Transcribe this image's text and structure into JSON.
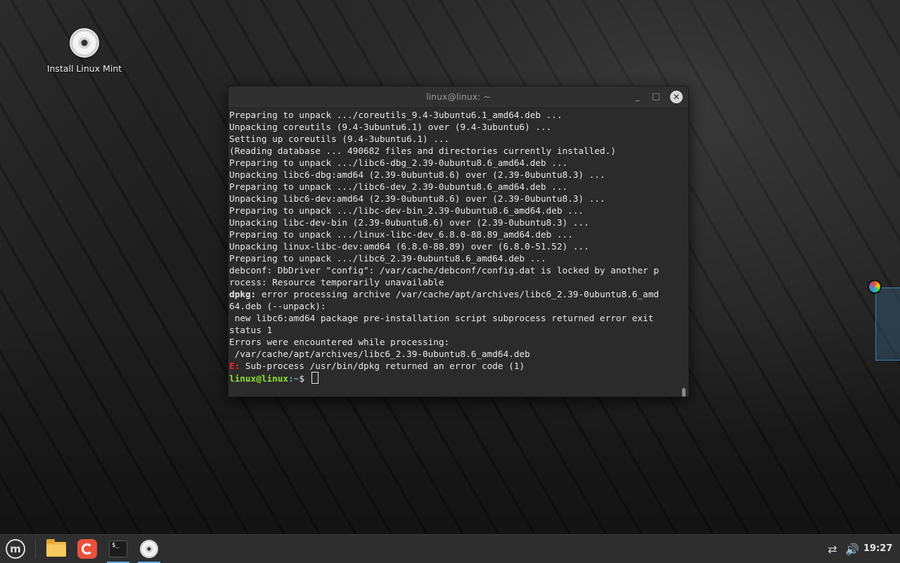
{
  "desktop": {
    "icon_label": "Install Linux Mint"
  },
  "window": {
    "title": "linux@linux: ~",
    "minimize_glyph": "_",
    "maximize_glyph": "□",
    "close_glyph": "✕"
  },
  "terminal": {
    "lines": [
      "Preparing to unpack .../coreutils_9.4-3ubuntu6.1_amd64.deb ...",
      "Unpacking coreutils (9.4-3ubuntu6.1) over (9.4-3ubuntu6) ...",
      "Setting up coreutils (9.4-3ubuntu6.1) ...",
      "(Reading database ... 490682 files and directories currently installed.)",
      "Preparing to unpack .../libc6-dbg_2.39-0ubuntu8.6_amd64.deb ...",
      "Unpacking libc6-dbg:amd64 (2.39-0ubuntu8.6) over (2.39-0ubuntu8.3) ...",
      "Preparing to unpack .../libc6-dev_2.39-0ubuntu8.6_amd64.deb ...",
      "Unpacking libc6-dev:amd64 (2.39-0ubuntu8.6) over (2.39-0ubuntu8.3) ...",
      "Preparing to unpack .../libc-dev-bin_2.39-0ubuntu8.6_amd64.deb ...",
      "Unpacking libc-dev-bin (2.39-0ubuntu8.6) over (2.39-0ubuntu8.3) ...",
      "Preparing to unpack .../linux-libc-dev_6.8.0-88.89_amd64.deb ...",
      "Unpacking linux-libc-dev:amd64 (6.8.0-88.89) over (6.8.0-51.52) ...",
      "Preparing to unpack .../libc6_2.39-0ubuntu8.6_amd64.deb ...",
      "debconf: DbDriver \"config\": /var/cache/debconf/config.dat is locked by another p",
      "rocess: Resource temporarily unavailable"
    ],
    "dpkg_label": "dpkg:",
    "dpkg_line1": " error processing archive /var/cache/apt/archives/libc6_2.39-0ubuntu8.6_amd",
    "lines_after": [
      "64.deb (--unpack):",
      " new libc6:amd64 package pre-installation script subprocess returned error exit",
      "status 1",
      "Errors were encountered while processing:",
      " /var/cache/apt/archives/libc6_2.39-0ubuntu8.6_amd64.deb"
    ],
    "error_label": "E:",
    "error_text": " Sub-process /usr/bin/dpkg returned an error code (1)",
    "prompt_user": "linux@linux",
    "prompt_path": ":~",
    "prompt_symbol": "$ "
  },
  "taskbar": {
    "menu_glyph": "m",
    "terminal_glyph": "$_",
    "clock": "19:27",
    "network_glyph": "⇄",
    "volume_glyph": "🔊"
  }
}
